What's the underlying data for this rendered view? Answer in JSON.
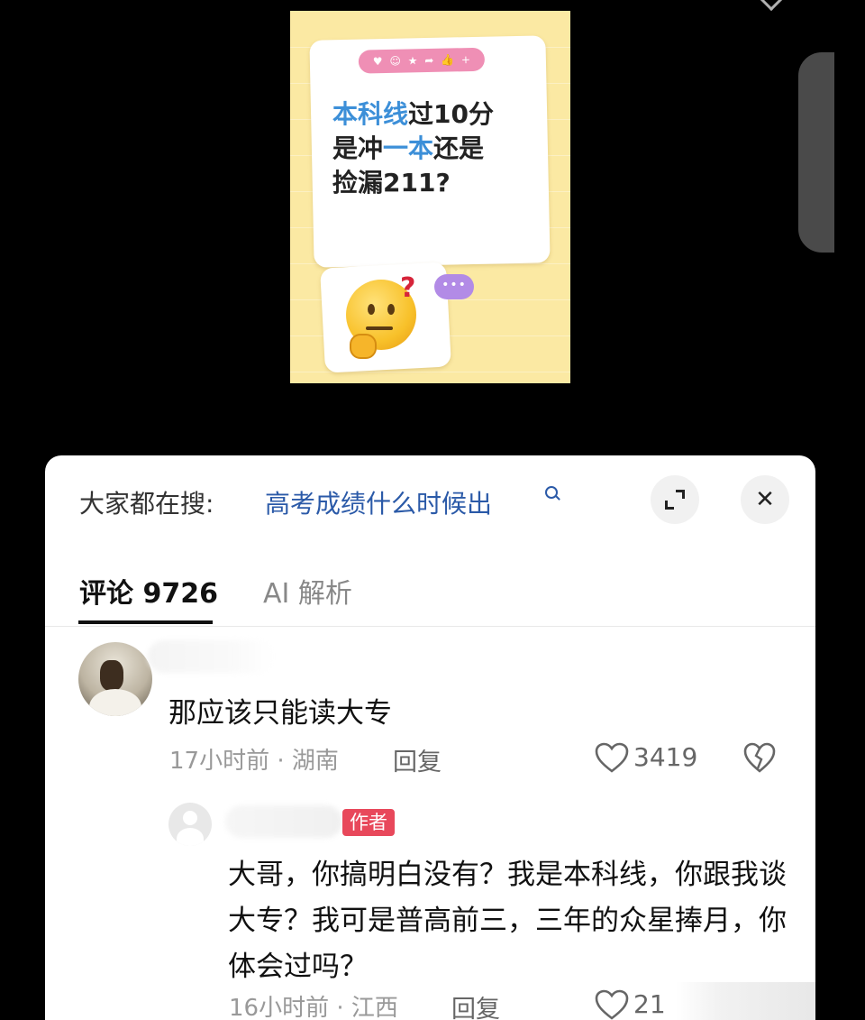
{
  "poster": {
    "reaction_icons": [
      "♥",
      "☺",
      "★",
      "➦",
      "👍",
      "+"
    ],
    "line1_blue": "本科线",
    "line1_rest": "过10分",
    "line2_a": "是冲",
    "line2_blue": "一本",
    "line2_b": "还是",
    "line3": "捡漏211?",
    "question_mark": "?",
    "bubble": "•••"
  },
  "search": {
    "prefix": "大家都在搜:",
    "term": "高考成绩什么时候出"
  },
  "buttons": {
    "close_label": "✕"
  },
  "tabs": {
    "comments": "评论 9726",
    "ai": "AI 解析"
  },
  "comments": [
    {
      "text": "那应该只能读大专",
      "meta": "17小时前 · 湖南",
      "reply": "回复",
      "likes": "3419"
    },
    {
      "badge": "作者",
      "text": "大哥，你搞明白没有？我是本科线，你跟我谈大专？我可是普高前三，三年的众星捧月，你体会过吗？",
      "meta": "16小时前 · 江西",
      "reply": "回复",
      "likes": "21"
    }
  ],
  "colors": {
    "accent_blue": "#2b5aa8",
    "author_badge": "#e8485b",
    "poster_bg": "#fbe9a3"
  }
}
